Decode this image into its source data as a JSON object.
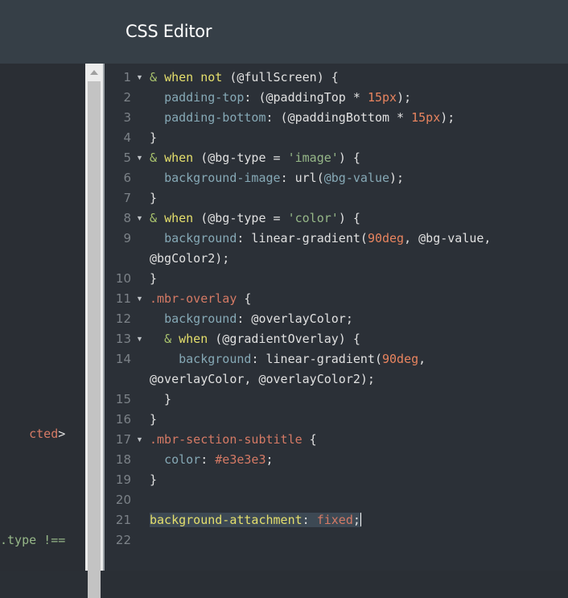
{
  "header": {
    "title": "CSS Editor"
  },
  "left_pane": {
    "fragments": [
      {
        "id": "frag-1",
        "text": "cted",
        "tail": ">"
      },
      {
        "id": "frag-2",
        "text": ".type !=="
      }
    ]
  },
  "colors": {
    "keyword": "#e5df6c",
    "property": "#86a9b6",
    "selector": "#d57a65",
    "number": "#e8845f",
    "string": "#96b788",
    "plain": "#e0e0e0",
    "ampersand": "#a8c26d",
    "gutter": "#7c8288"
  },
  "editor": {
    "lines": [
      {
        "num": "1",
        "fold": true,
        "spans": [
          {
            "t": "& ",
            "c": "ampersand"
          },
          {
            "t": "when not",
            "c": "keyword"
          },
          {
            "t": " (@fullScreen) {",
            "c": "plain"
          }
        ]
      },
      {
        "num": "2",
        "fold": false,
        "spans": [
          {
            "t": "  ",
            "c": "plain"
          },
          {
            "t": "padding-top",
            "c": "property"
          },
          {
            "t": ": (@paddingTop * ",
            "c": "plain"
          },
          {
            "t": "15px",
            "c": "number"
          },
          {
            "t": ");",
            "c": "plain"
          }
        ]
      },
      {
        "num": "3",
        "fold": false,
        "spans": [
          {
            "t": "  ",
            "c": "plain"
          },
          {
            "t": "padding-bottom",
            "c": "property"
          },
          {
            "t": ": (@paddingBottom * ",
            "c": "plain"
          },
          {
            "t": "15px",
            "c": "number"
          },
          {
            "t": ");",
            "c": "plain"
          }
        ]
      },
      {
        "num": "4",
        "fold": false,
        "spans": [
          {
            "t": "}",
            "c": "plain"
          }
        ]
      },
      {
        "num": "5",
        "fold": true,
        "spans": [
          {
            "t": "& ",
            "c": "ampersand"
          },
          {
            "t": "when",
            "c": "keyword"
          },
          {
            "t": " (@bg-type = ",
            "c": "plain"
          },
          {
            "t": "'image'",
            "c": "string"
          },
          {
            "t": ") {",
            "c": "plain"
          }
        ]
      },
      {
        "num": "6",
        "fold": false,
        "spans": [
          {
            "t": "  ",
            "c": "plain"
          },
          {
            "t": "background-image",
            "c": "property"
          },
          {
            "t": ": url(",
            "c": "plain"
          },
          {
            "t": "@bg-value",
            "c": "property"
          },
          {
            "t": ");",
            "c": "plain"
          }
        ]
      },
      {
        "num": "7",
        "fold": false,
        "spans": [
          {
            "t": "}",
            "c": "plain"
          }
        ]
      },
      {
        "num": "8",
        "fold": true,
        "spans": [
          {
            "t": "& ",
            "c": "ampersand"
          },
          {
            "t": "when",
            "c": "keyword"
          },
          {
            "t": " (@bg-type = ",
            "c": "plain"
          },
          {
            "t": "'color'",
            "c": "string"
          },
          {
            "t": ") {",
            "c": "plain"
          }
        ]
      },
      {
        "num": "9",
        "fold": false,
        "spans": [
          {
            "t": "  ",
            "c": "plain"
          },
          {
            "t": "background",
            "c": "property"
          },
          {
            "t": ": linear-gradient(",
            "c": "plain"
          },
          {
            "t": "90deg",
            "c": "number"
          },
          {
            "t": ", @bg-value,",
            "c": "plain"
          }
        ]
      },
      {
        "num": "",
        "fold": false,
        "spans": [
          {
            "t": "@bgColor2);",
            "c": "plain"
          }
        ]
      },
      {
        "num": "10",
        "fold": false,
        "spans": [
          {
            "t": "}",
            "c": "plain"
          }
        ]
      },
      {
        "num": "11",
        "fold": true,
        "spans": [
          {
            "t": ".mbr-overlay",
            "c": "selector"
          },
          {
            "t": " {",
            "c": "plain"
          }
        ]
      },
      {
        "num": "12",
        "fold": false,
        "spans": [
          {
            "t": "  ",
            "c": "plain"
          },
          {
            "t": "background",
            "c": "property"
          },
          {
            "t": ": @overlayColor;",
            "c": "plain"
          }
        ]
      },
      {
        "num": "13",
        "fold": true,
        "spans": [
          {
            "t": "  ",
            "c": "plain"
          },
          {
            "t": "& ",
            "c": "ampersand"
          },
          {
            "t": "when",
            "c": "keyword"
          },
          {
            "t": " (@gradientOverlay) {",
            "c": "plain"
          }
        ]
      },
      {
        "num": "14",
        "fold": false,
        "spans": [
          {
            "t": "    ",
            "c": "plain"
          },
          {
            "t": "background",
            "c": "property"
          },
          {
            "t": ": linear-gradient(",
            "c": "plain"
          },
          {
            "t": "90deg",
            "c": "number"
          },
          {
            "t": ",",
            "c": "plain"
          }
        ]
      },
      {
        "num": "",
        "fold": false,
        "spans": [
          {
            "t": "@overlayColor, @overlayColor2);",
            "c": "plain"
          }
        ]
      },
      {
        "num": "15",
        "fold": false,
        "spans": [
          {
            "t": "  }",
            "c": "plain"
          }
        ]
      },
      {
        "num": "16",
        "fold": false,
        "spans": [
          {
            "t": "}",
            "c": "plain"
          }
        ]
      },
      {
        "num": "17",
        "fold": true,
        "spans": [
          {
            "t": ".mbr-section-subtitle",
            "c": "selector"
          },
          {
            "t": " {",
            "c": "plain"
          }
        ]
      },
      {
        "num": "18",
        "fold": false,
        "spans": [
          {
            "t": "  ",
            "c": "plain"
          },
          {
            "t": "color",
            "c": "property"
          },
          {
            "t": ": ",
            "c": "plain"
          },
          {
            "t": "#e3e3e3",
            "c": "selector"
          },
          {
            "t": ";",
            "c": "plain"
          }
        ]
      },
      {
        "num": "19",
        "fold": false,
        "spans": [
          {
            "t": "}",
            "c": "plain"
          }
        ]
      },
      {
        "num": "20",
        "fold": false,
        "spans": []
      },
      {
        "num": "21",
        "fold": false,
        "highlight": true,
        "cursor": true,
        "spans": [
          {
            "t": "background-attachment",
            "c": "keyword"
          },
          {
            "t": ": ",
            "c": "plain"
          },
          {
            "t": "fixed",
            "c": "selector"
          },
          {
            "t": ";",
            "c": "plain"
          }
        ]
      },
      {
        "num": "22",
        "fold": false,
        "spans": []
      }
    ]
  }
}
